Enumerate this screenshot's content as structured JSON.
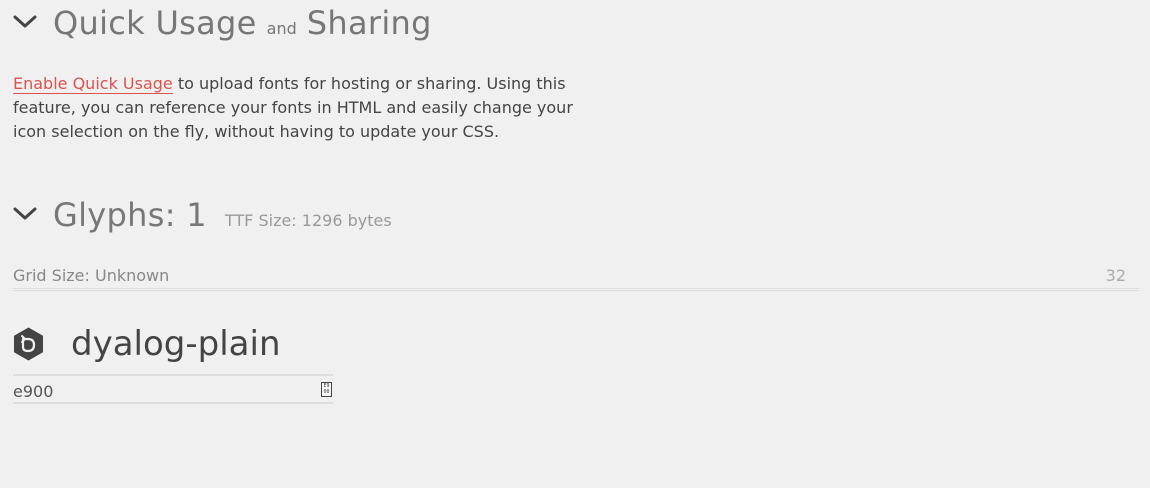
{
  "quick_usage": {
    "title_part1": "Quick Usage",
    "title_and": "and",
    "title_part2": "Sharing",
    "enable_link": "Enable Quick Usage",
    "description": " to upload fonts for hosting or sharing. Using this feature, you can reference your fonts in HTML and easily change your icon selection on the fly, without having to update your CSS."
  },
  "glyphs": {
    "title": "Glyphs: 1",
    "ttf_size": "TTF Size: 1296 bytes",
    "grid_label": "Grid Size: Unknown",
    "grid_value": "32"
  },
  "glyph_item": {
    "name": "dyalog-plain",
    "code": "e900",
    "code_glyph_top": "E9",
    "code_glyph_bottom": "00",
    "icon": "dyalog-hexagon-icon"
  },
  "colors": {
    "background": "#f0f0f0",
    "link": "#d9534f",
    "heading": "#777777",
    "text": "#444444"
  }
}
